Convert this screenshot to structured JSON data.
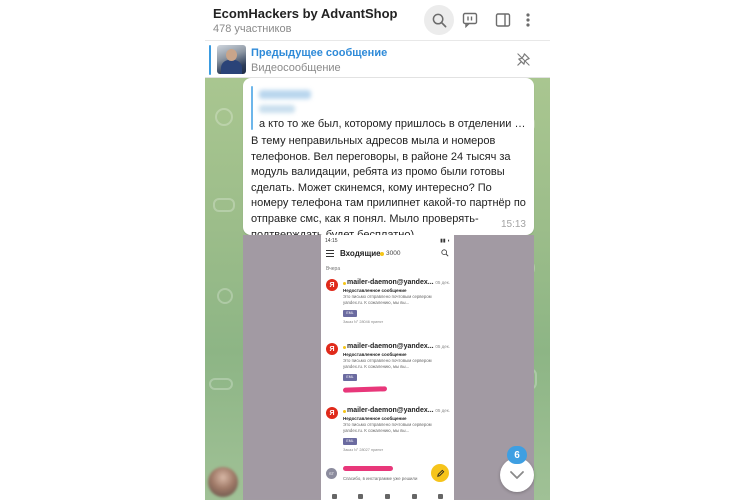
{
  "header": {
    "title": "EcomHackers by AdvantShop",
    "subtitle": "478 участников",
    "icons": [
      "search-icon",
      "comments-icon",
      "sidebar-icon",
      "more-icon"
    ]
  },
  "pinned": {
    "title": "Предыдущее сообщение",
    "subtitle": "Видеосообщение",
    "icon": "unpin-icon"
  },
  "message": {
    "reply_text": "а кто то же был, которому пришлось в отделении до...",
    "text": "В тему неправильных адресов мыла и номеров телефонов. Вел переговоры, в районе 24 тысяч за модуль валидации, ребята из промо были готовы сделать. Может скинемся, кому интересно? По номеру телефона там прилипнет какой-то партнёр по отправке смс, как я понял. Мыло проверять-подтверждать будет бесплатно)",
    "time": "15:13"
  },
  "screenshot": {
    "status_time": "14:15",
    "inbox_title": "Входящие",
    "inbox_count": "3000",
    "date_label": "Вчера",
    "mails": [
      {
        "from": "mailer-daemon@yandex...",
        "date": "05 дек.",
        "subject": "Недоставленное сообщение",
        "preview": "Это письмо отправлено почтовым сервером yandex.ru. К сожалению, мы вы...",
        "attachment": "EML",
        "attachment_name": "Заказ N° 28046 принят"
      },
      {
        "from": "mailer-daemon@yandex...",
        "date": "05 дек.",
        "subject": "Недоставленное сообщение",
        "preview": "Это письмо отправлено почтовым сервером yandex.ru. К сожалению, мы вы...",
        "attachment": "EML",
        "attachment_name": ""
      },
      {
        "from": "mailer-daemon@yandex...",
        "date": "05 дек.",
        "subject": "Недоставленное сообщение",
        "preview": "Это письмо отправлено почтовым сервером yandex.ru. К сожалению, мы вы...",
        "attachment": "EML",
        "attachment_name": "Заказ N° 28027 принят"
      }
    ],
    "last_avatar": "ST",
    "last_preview": "Спасибо, в инстаграмме уже решили",
    "ya_letter": "Я"
  },
  "unread_count": "6",
  "colors": {
    "accent": "#3e9fe2",
    "chat_background": "#9cbd8a",
    "yandex_red": "#e02a1b",
    "redaction_pink": "#e8377a",
    "compose_yellow": "#f6c41b"
  }
}
